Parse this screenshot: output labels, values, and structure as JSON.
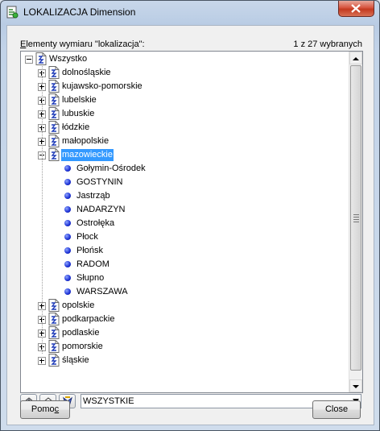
{
  "window": {
    "title": "LOKALIZACJA Dimension"
  },
  "list": {
    "label_prefix": "E",
    "label_rest": "lementy wymiaru \"lokalizacja\":",
    "selection_count": "1 z 27 wybranych"
  },
  "tree": {
    "root": "Wszystko",
    "regions_before": [
      "dolnośląskie",
      "kujawsko-pomorskie",
      "lubelskie",
      "lubuskie",
      "łódzkie",
      "małopolskie"
    ],
    "expanded_region": "mazowieckie",
    "cities": [
      "Gołymin-Ośrodek",
      "GOSTYNIN",
      "Jastrząb",
      "NADARZYN",
      "Ostrołęka",
      "Płock",
      "Płońsk",
      "RADOM",
      "Słupno",
      "WARSZAWA"
    ],
    "regions_after": [
      "opolskie",
      "podkarpackie",
      "podlaskie",
      "pomorskie",
      "śląskie"
    ]
  },
  "filter": {
    "selected": "WSZYSTKIE"
  },
  "buttons": {
    "help_prefix": "Pomo",
    "help_mnemonic": "c",
    "close": "Close"
  },
  "icons": [
    "app-icon",
    "close-icon",
    "expand-icon",
    "collapse-icon",
    "dimension-node-icon",
    "member-dot-icon",
    "tool-icon"
  ]
}
